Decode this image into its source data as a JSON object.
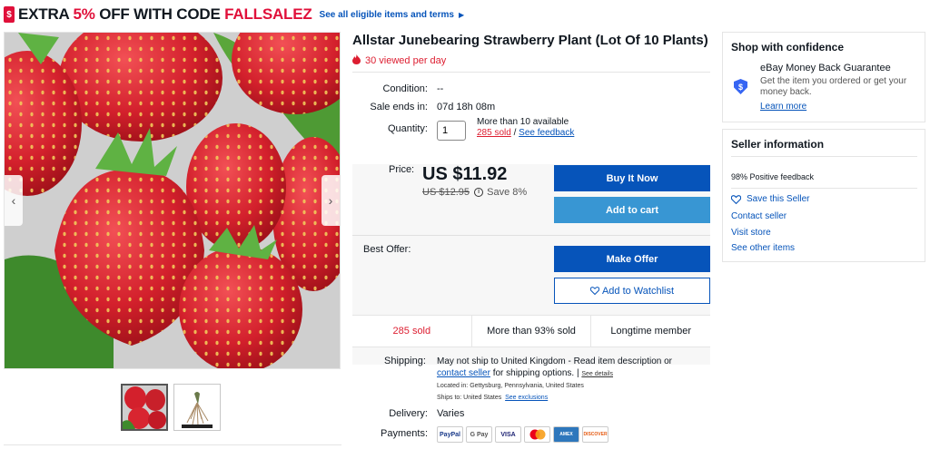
{
  "promo": {
    "tag": "$",
    "prefix": "EXTRA ",
    "percent": "5%",
    "middle": " OFF WITH CODE ",
    "code": "FALLSALEZ",
    "link": "See all eligible items and terms",
    "arrow": "▶"
  },
  "gallery": {
    "prev": "‹",
    "next": "›",
    "thumbnails": [
      "strawberries",
      "bare-root plant"
    ]
  },
  "listing": {
    "title": "Allstar Junebearing Strawberry Plant (Lot Of 10 Plants)",
    "viewed": "30 viewed per day",
    "condition_label": "Condition:",
    "condition_value": "--",
    "sale_ends_label": "Sale ends in:",
    "sale_ends_value": "07d 18h 08m",
    "quantity_label": "Quantity:",
    "quantity_value": "1",
    "availability": "More than 10 available",
    "sold_link": "285 sold",
    "sold_sep": " / ",
    "feedback_link": "See feedback"
  },
  "price": {
    "label": "Price:",
    "current": "US $11.92",
    "was": "US $12.95",
    "info": "i",
    "save": "Save 8%",
    "buy_now": "Buy It Now",
    "add_to_cart": "Add to cart",
    "best_offer_label": "Best Offer:",
    "make_offer": "Make Offer",
    "watchlist": "Add to Watchlist",
    "watch_icon": "heart-icon"
  },
  "stats": [
    "285 sold",
    "More than 93% sold",
    "Longtime member"
  ],
  "shipping": {
    "label": "Shipping:",
    "line1": "May not ship to United Kingdom - Read item description or",
    "contact_link": "contact seller",
    "line2_rest": " for shipping options. |",
    "see_details": "See details",
    "located": "Located in:  Gettysburg, Pennsylvania, United States",
    "ships_to": "Ships to:  United States",
    "exclusions": "See exclusions",
    "delivery_label": "Delivery:",
    "delivery_value": "Varies",
    "payments_label": "Payments:",
    "payment_methods": [
      "PayPal",
      "G Pay",
      "VISA",
      "MC",
      "AMEX",
      "DISCOVER"
    ]
  },
  "confidence": {
    "title": "Shop with confidence",
    "guarantee_title": "eBay Money Back Guarantee",
    "guarantee_desc": "Get the item you ordered or get your money back.",
    "learn_more": "Learn more",
    "shield_glyph": "$"
  },
  "seller": {
    "title": "Seller information",
    "feedback": "98% Positive feedback",
    "save_seller": "Save this Seller",
    "contact": "Contact seller",
    "visit_store": "Visit store",
    "other_items": "See other items"
  },
  "colors": {
    "accent_blue": "#0654ba",
    "light_blue": "#3896d3",
    "sale_red": "#dd1e31",
    "promo_red": "#e0103a"
  }
}
